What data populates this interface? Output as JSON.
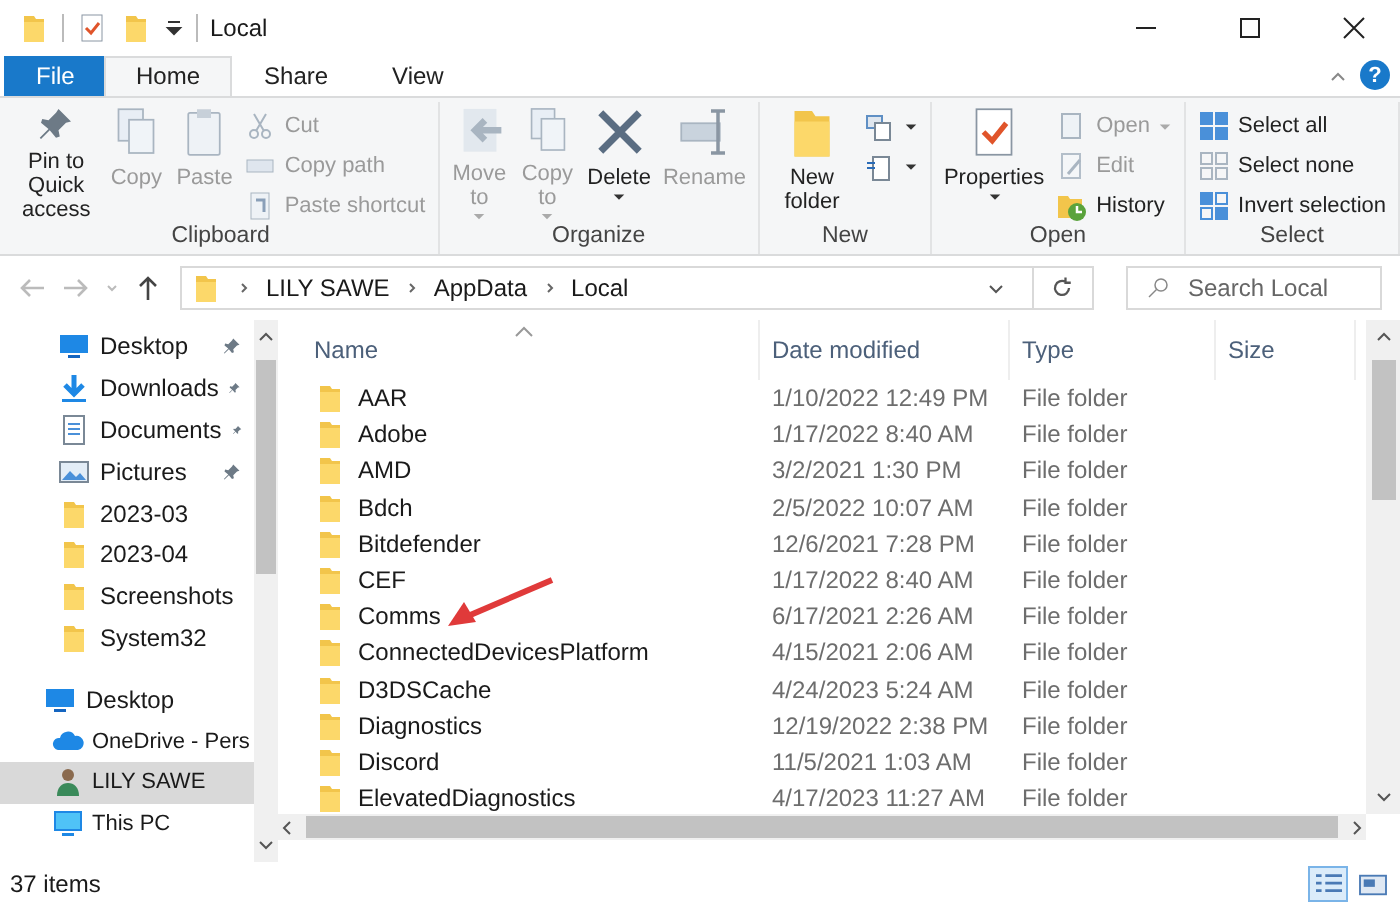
{
  "title_bar": {
    "title": "Local"
  },
  "ribbon_tabs": [
    {
      "label": "File",
      "kind": "file",
      "selected": false
    },
    {
      "label": "Home",
      "kind": "tab",
      "selected": true
    },
    {
      "label": "Share",
      "kind": "tab",
      "selected": false
    },
    {
      "label": "View",
      "kind": "tab",
      "selected": false
    }
  ],
  "help_button": "?",
  "ribbon": {
    "groups": [
      {
        "label": "Clipboard",
        "columns": [
          {
            "kind": "large",
            "label": "Pin to Quick access",
            "disabled": false,
            "dropdown": false
          },
          {
            "kind": "large",
            "label": "Copy",
            "disabled": true,
            "dropdown": false
          },
          {
            "kind": "large",
            "label": "Paste",
            "disabled": true,
            "dropdown": false
          },
          {
            "kind": "stack",
            "items": [
              {
                "label": "Cut",
                "disabled": true,
                "dropdown": false
              },
              {
                "label": "Copy path",
                "disabled": true,
                "dropdown": false
              },
              {
                "label": "Paste shortcut",
                "disabled": true,
                "dropdown": false
              }
            ]
          }
        ]
      },
      {
        "label": "Organize",
        "columns": [
          {
            "kind": "large",
            "label": "Move to",
            "disabled": true,
            "dropdown": true
          },
          {
            "kind": "large",
            "label": "Copy to",
            "disabled": true,
            "dropdown": true
          },
          {
            "kind": "large",
            "label": "Delete",
            "disabled": false,
            "dropdown": true
          },
          {
            "kind": "large",
            "label": "Rename",
            "disabled": true,
            "dropdown": false
          }
        ]
      },
      {
        "label": "New",
        "columns": [
          {
            "kind": "large",
            "label": "New folder",
            "disabled": false,
            "dropdown": false
          },
          {
            "kind": "stack",
            "items": [
              {
                "disabled": false,
                "dropdown": true
              },
              {
                "disabled": false,
                "dropdown": true
              }
            ]
          }
        ]
      },
      {
        "label": "Open",
        "columns": [
          {
            "kind": "large",
            "label": "Properties",
            "disabled": false,
            "dropdown": true
          },
          {
            "kind": "stack",
            "items": [
              {
                "label": "Open",
                "disabled": true,
                "dropdown": true
              },
              {
                "label": "Edit",
                "disabled": true,
                "dropdown": false
              },
              {
                "label": "History",
                "disabled": false,
                "dropdown": false
              }
            ]
          }
        ]
      },
      {
        "label": "Select",
        "columns": [
          {
            "kind": "stack",
            "items": [
              {
                "label": "Select all",
                "disabled": false,
                "dropdown": false
              },
              {
                "label": "Select none",
                "disabled": false,
                "dropdown": false
              },
              {
                "label": "Invert selection",
                "disabled": false,
                "dropdown": false
              }
            ]
          }
        ]
      }
    ]
  },
  "address_bar": {
    "breadcrumbs": [
      "LILY SAWE",
      "AppData",
      "Local"
    ]
  },
  "search": {
    "placeholder": "Search Local"
  },
  "navigation_pane": {
    "quick_access": [
      {
        "label": "Desktop",
        "kind": "desktop",
        "pinned": true
      },
      {
        "label": "Downloads",
        "kind": "downloads",
        "pinned": true
      },
      {
        "label": "Documents",
        "kind": "documents",
        "pinned": true
      },
      {
        "label": "Pictures",
        "kind": "pictures",
        "pinned": true
      },
      {
        "label": "2023-03",
        "kind": "folder",
        "pinned": false
      },
      {
        "label": "2023-04",
        "kind": "folder",
        "pinned": false
      },
      {
        "label": "Screenshots",
        "kind": "folder",
        "pinned": false
      },
      {
        "label": "System32",
        "kind": "folder",
        "pinned": false
      }
    ],
    "tree": [
      {
        "label": "Desktop",
        "kind": "desktop",
        "selected": false,
        "children": [
          {
            "label": "OneDrive - Pers",
            "kind": "cloud",
            "selected": false
          },
          {
            "label": "LILY SAWE",
            "kind": "user",
            "selected": true
          },
          {
            "label": "This PC",
            "kind": "pc",
            "selected": false
          }
        ]
      }
    ]
  },
  "file_list": {
    "columns": [
      {
        "label": "Name",
        "sorted": true
      },
      {
        "label": "Date modified",
        "sorted": false
      },
      {
        "label": "Type",
        "sorted": false
      },
      {
        "label": "Size",
        "sorted": false
      }
    ],
    "rows": [
      {
        "name": "AAR",
        "date_modified": "1/10/2022 12:49 PM",
        "type": "File folder"
      },
      {
        "name": "Adobe",
        "date_modified": "1/17/2022 8:40 AM",
        "type": "File folder"
      },
      {
        "name": "AMD",
        "date_modified": "3/2/2021 1:30 PM",
        "type": "File folder"
      },
      {
        "name": "Bdch",
        "date_modified": "2/5/2022 10:07 AM",
        "type": "File folder"
      },
      {
        "name": "Bitdefender",
        "date_modified": "12/6/2021 7:28 PM",
        "type": "File folder"
      },
      {
        "name": "CEF",
        "date_modified": "1/17/2022 8:40 AM",
        "type": "File folder"
      },
      {
        "name": "Comms",
        "date_modified": "6/17/2021 2:26 AM",
        "type": "File folder"
      },
      {
        "name": "ConnectedDevicesPlatform",
        "date_modified": "4/15/2021 2:06 AM",
        "type": "File folder"
      },
      {
        "name": "D3DSCache",
        "date_modified": "4/24/2023 5:24 AM",
        "type": "File folder"
      },
      {
        "name": "Diagnostics",
        "date_modified": "12/19/2022 2:38 PM",
        "type": "File folder"
      },
      {
        "name": "Discord",
        "date_modified": "11/5/2021 1:03 AM",
        "type": "File folder"
      },
      {
        "name": "ElevatedDiagnostics",
        "date_modified": "4/17/2023 11:27 AM",
        "type": "File folder"
      }
    ]
  },
  "status_bar": {
    "item_count": "37 items",
    "view_buttons": [
      {
        "kind": "details",
        "selected": true
      },
      {
        "kind": "large-icons",
        "selected": false
      }
    ]
  }
}
